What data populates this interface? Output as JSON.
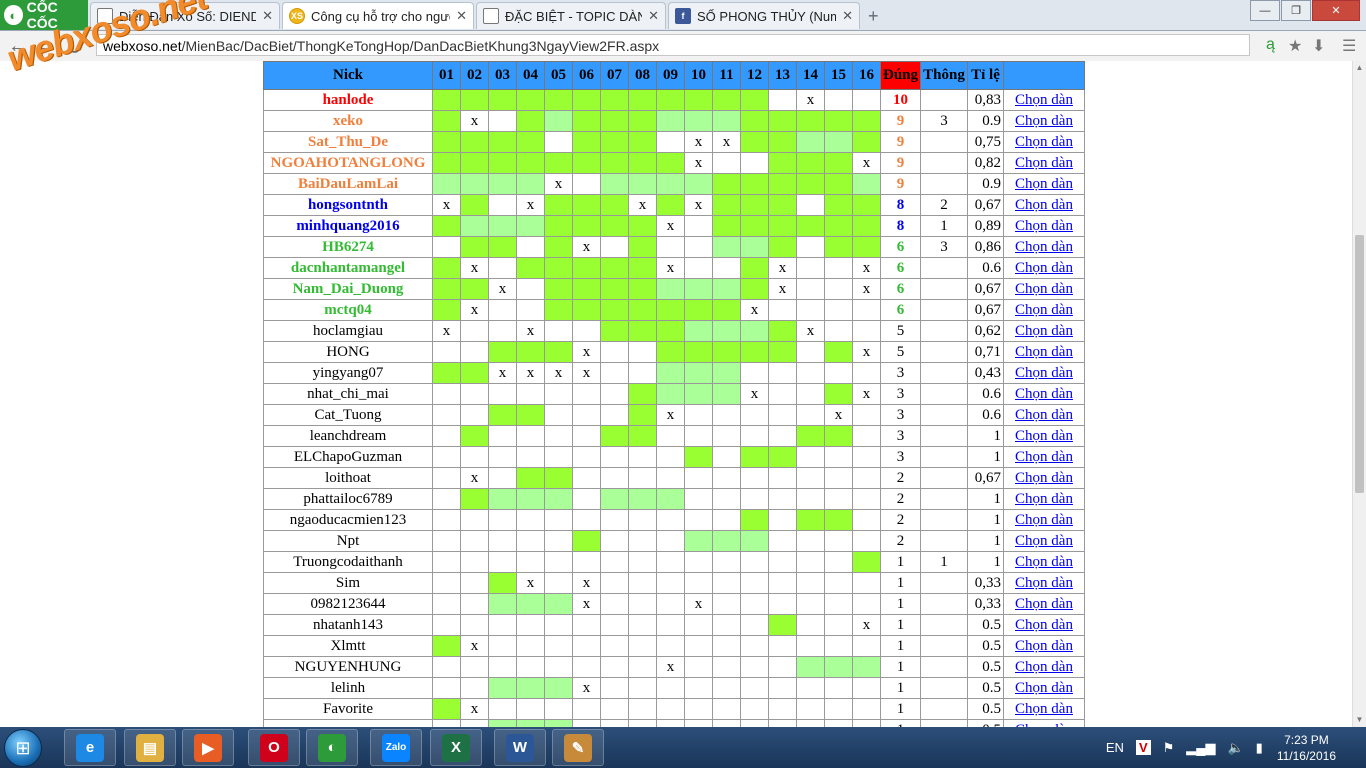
{
  "browser": {
    "logo_text": "CỐC CỐC",
    "tabs": [
      {
        "label": "Diễn Đàn Xổ Số: DIENDAN",
        "icon": "page-icon",
        "active": false
      },
      {
        "label": "Công cụ hỗ trợ cho người",
        "icon": "xs-icon",
        "active": true
      },
      {
        "label": "ĐẶC BIỆT - TOPIC DÀN ĐẶ",
        "icon": "page-icon",
        "active": false
      },
      {
        "label": "SỐ PHONG THỦY (Numero",
        "icon": "facebook-icon",
        "active": false
      }
    ],
    "url_prefix": "webxoso.net",
    "url_path": "/MienBac/DacBiet/ThongKeTongHop/DanDacBietKhung3NgayView2FR.aspx"
  },
  "watermark": "webxoso.net",
  "table": {
    "headers": {
      "nick": "Nick",
      "days": [
        "01",
        "02",
        "03",
        "04",
        "05",
        "06",
        "07",
        "08",
        "09",
        "10",
        "11",
        "12",
        "13",
        "14",
        "15",
        "16"
      ],
      "dung": "Đúng",
      "thong": "Thông",
      "tile": "Tỉ lệ"
    },
    "link_label": "Chọn dàn",
    "legend": {
      "G": "#99ff33",
      "L": "#aaff99",
      "X": "x",
      ".": "empty"
    },
    "rows": [
      {
        "nick": "hanlode",
        "color": "red",
        "cells": "GGGGGGGGGGGG X..X",
        "dung": "10",
        "thong": "",
        "tile": "0,83"
      },
      {
        "nick": "xeko",
        "color": "orange",
        "cells": "GX.GLGGGLLLGGGGG",
        "dung": "9",
        "thong": "3",
        "tile": "0.9"
      },
      {
        "nick": "Sat_Thu_De",
        "color": "orange",
        "cells": "GGGG.GGG.XXGGLLG",
        "dung": "9",
        "thong": "",
        "tile": "0,75"
      },
      {
        "nick": "NGOAHOTANGLONG",
        "color": "orange",
        "cells": "GGGGGGGGGX..GGGX",
        "dung": "9",
        "thong": "",
        "tile": "0,82"
      },
      {
        "nick": "BaiDauLamLai",
        "color": "orange",
        "cells": "LLLLX.LLLLGGGGGL",
        "dung": "9",
        "thong": "",
        "tile": "0.9"
      },
      {
        "nick": "hongsontnth",
        "color": "blue",
        "cells": "XG.XGGGXGXGGG.GG",
        "dung": "8",
        "thong": "2",
        "tile": "0,67"
      },
      {
        "nick": "minhquang2016",
        "color": "blue",
        "cells": "GLLLGGGGX.GGGGGG",
        "dung": "8",
        "thong": "1",
        "tile": "0,89"
      },
      {
        "nick": "HB6274",
        "color": "green",
        "cells": ".GG.GX.G..LLG.GG",
        "dung": "6",
        "thong": "3",
        "tile": "0,86"
      },
      {
        "nick": "dacnhantamangel",
        "color": "green",
        "cells": "GX.GGGGGX..GX..X",
        "dung": "6",
        "thong": "",
        "tile": "0.6"
      },
      {
        "nick": "Nam_Dai_Duong",
        "color": "green",
        "cells": "GGX.GGGGLLLGX..X",
        "dung": "6",
        "thong": "",
        "tile": "0,67"
      },
      {
        "nick": "mctq04",
        "color": "green",
        "cells": "GX..GGGGGGGX....",
        "dung": "6",
        "thong": "",
        "tile": "0,67"
      },
      {
        "nick": "hoclamgiau",
        "color": "black",
        "cells": "X..X..GGGLLLGX..",
        "dung": "5",
        "thong": "",
        "tile": "0,62"
      },
      {
        "nick": "HONG",
        "color": "black",
        "cells": "..GGGX..GGGGG.GX",
        "dung": "5",
        "thong": "",
        "tile": "0,71"
      },
      {
        "nick": "yingyang07",
        "color": "black",
        "cells": "GGXXXX..LLL.....",
        "dung": "3",
        "thong": "",
        "tile": "0,43"
      },
      {
        "nick": "nhat_chi_mai",
        "color": "black",
        "cells": ".......GLLLX..GX",
        "dung": "3",
        "thong": "",
        "tile": "0.6"
      },
      {
        "nick": "Cat_Tuong",
        "color": "black",
        "cells": "..GG...GX.....X.",
        "dung": "3",
        "thong": "",
        "tile": "0.6"
      },
      {
        "nick": "leanchdream",
        "color": "black",
        "cells": ".G....GG.....GG.",
        "dung": "3",
        "thong": "",
        "tile": "1"
      },
      {
        "nick": "ELChapoGuzman",
        "color": "black",
        "cells": ".........G.GG...",
        "dung": "3",
        "thong": "",
        "tile": "1"
      },
      {
        "nick": "loithoat",
        "color": "black",
        "cells": ".X.GG..........",
        "dung": "2",
        "thong": "",
        "tile": "0,67"
      },
      {
        "nick": "phattailoc6789",
        "color": "black",
        "cells": ".GLLL.LLL.......",
        "dung": "2",
        "thong": "",
        "tile": "1"
      },
      {
        "nick": "ngaoducacmien123",
        "color": "black",
        "cells": "...........G.GG.",
        "dung": "2",
        "thong": "",
        "tile": "1"
      },
      {
        "nick": "Npt",
        "color": "black",
        "cells": ".....G...LLL....",
        "dung": "2",
        "thong": "",
        "tile": "1"
      },
      {
        "nick": "Truongcodaithanh",
        "color": "black",
        "cells": "...............G",
        "dung": "1",
        "thong": "1",
        "tile": "1"
      },
      {
        "nick": "Sim",
        "color": "black",
        "cells": "..GX.X..........",
        "dung": "1",
        "thong": "",
        "tile": "0,33"
      },
      {
        "nick": "0982123644",
        "color": "black",
        "cells": "..LLLX...X......",
        "dung": "1",
        "thong": "",
        "tile": "0,33"
      },
      {
        "nick": "nhatanh143",
        "color": "black",
        "cells": "............G..X",
        "dung": "1",
        "thong": "",
        "tile": "0.5"
      },
      {
        "nick": "Xlmtt",
        "color": "black",
        "cells": "GX..............",
        "dung": "1",
        "thong": "",
        "tile": "0.5"
      },
      {
        "nick": "NGUYENHUNG",
        "color": "black",
        "cells": "........X....LLL",
        "dung": "1",
        "thong": "",
        "tile": "0.5"
      },
      {
        "nick": "lelinh",
        "color": "black",
        "cells": "..LLLX..........",
        "dung": "1",
        "thong": "",
        "tile": "0.5"
      },
      {
        "nick": "Favorite",
        "color": "black",
        "cells": "GX..............",
        "dung": "1",
        "thong": "",
        "tile": "0.5"
      },
      {
        "nick": "onzo",
        "color": "black",
        "cells": "..LLLX..........",
        "dung": "1",
        "thong": "",
        "tile": "0.5"
      }
    ]
  },
  "taskbar": {
    "apps": [
      {
        "name": "internet-explorer",
        "glyph": "e",
        "color": "#1e88e5"
      },
      {
        "name": "file-explorer",
        "glyph": "▤",
        "color": "#e0b040"
      },
      {
        "name": "media-player",
        "glyph": "▶",
        "color": "#e85d24"
      },
      {
        "name": "opera",
        "glyph": "O",
        "color": "#d0021b"
      },
      {
        "name": "coccoc",
        "glyph": "◐",
        "color": "#2d9b3a"
      },
      {
        "name": "zalo",
        "glyph": "Zalo",
        "color": "#0a84ff"
      },
      {
        "name": "excel",
        "glyph": "X",
        "color": "#1e7145"
      },
      {
        "name": "word",
        "glyph": "W",
        "color": "#2b5797"
      },
      {
        "name": "paint",
        "glyph": "✎",
        "color": "#c7893a"
      }
    ],
    "language": "EN",
    "time": "7:23 PM",
    "date": "11/16/2016"
  }
}
